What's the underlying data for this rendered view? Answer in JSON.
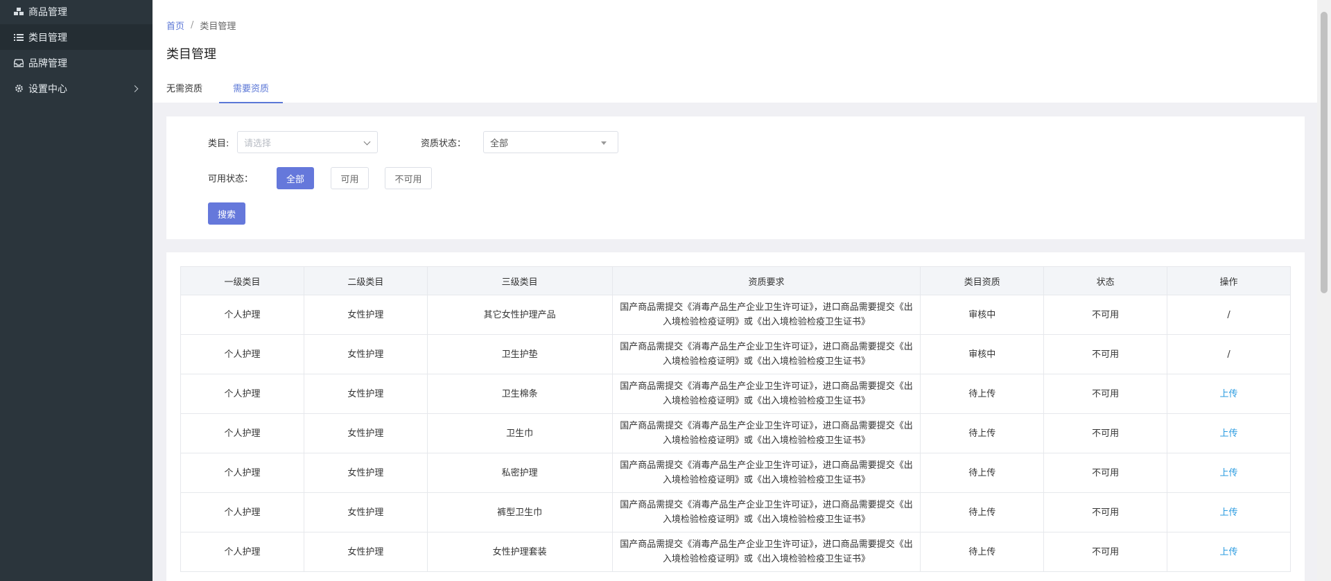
{
  "sidebar": {
    "items": [
      {
        "label": "商品管理",
        "icon": "cubes-icon"
      },
      {
        "label": "类目管理",
        "icon": "list-icon"
      },
      {
        "label": "品牌管理",
        "icon": "inbox-icon"
      },
      {
        "label": "设置中心",
        "icon": "gear-icon"
      }
    ]
  },
  "breadcrumb": {
    "home": "首页",
    "separator": "/",
    "current": "类目管理"
  },
  "page": {
    "title": "类目管理"
  },
  "tabs": [
    {
      "label": "无需资质"
    },
    {
      "label": "需要资质"
    }
  ],
  "filter": {
    "category_label": "类目:",
    "category_placeholder": "请选择",
    "qual_status_label": "资质状态：",
    "qual_status_value": "全部",
    "avail_label": "可用状态：",
    "avail_options": [
      "全部",
      "可用",
      "不可用"
    ],
    "search_label": "搜索"
  },
  "table": {
    "headers": [
      "一级类目",
      "二级类目",
      "三级类目",
      "资质要求",
      "类目资质",
      "状态",
      "操作"
    ],
    "rows": [
      {
        "c1": "个人护理",
        "c2": "女性护理",
        "c3": "其它女性护理产品",
        "req": "国产商品需提交《消毒产品生产企业卫生许可证》，进口商品需要提交《出入境检验检疫证明》或《出入境检验检疫卫生证书》",
        "qual": "审核中",
        "status": "不可用",
        "op": "/"
      },
      {
        "c1": "个人护理",
        "c2": "女性护理",
        "c3": "卫生护垫",
        "req": "国产商品需提交《消毒产品生产企业卫生许可证》，进口商品需要提交《出入境检验检疫证明》或《出入境检验检疫卫生证书》",
        "qual": "审核中",
        "status": "不可用",
        "op": "/"
      },
      {
        "c1": "个人护理",
        "c2": "女性护理",
        "c3": "卫生棉条",
        "req": "国产商品需提交《消毒产品生产企业卫生许可证》，进口商品需要提交《出入境检验检疫证明》或《出入境检验检疫卫生证书》",
        "qual": "待上传",
        "status": "不可用",
        "op": "上传"
      },
      {
        "c1": "个人护理",
        "c2": "女性护理",
        "c3": "卫生巾",
        "req": "国产商品需提交《消毒产品生产企业卫生许可证》，进口商品需要提交《出入境检验检疫证明》或《出入境检验检疫卫生证书》",
        "qual": "待上传",
        "status": "不可用",
        "op": "上传"
      },
      {
        "c1": "个人护理",
        "c2": "女性护理",
        "c3": "私密护理",
        "req": "国产商品需提交《消毒产品生产企业卫生许可证》，进口商品需要提交《出入境检验检疫证明》或《出入境检验检疫卫生证书》",
        "qual": "待上传",
        "status": "不可用",
        "op": "上传"
      },
      {
        "c1": "个人护理",
        "c2": "女性护理",
        "c3": "裤型卫生巾",
        "req": "国产商品需提交《消毒产品生产企业卫生许可证》，进口商品需要提交《出入境检验检疫证明》或《出入境检验检疫卫生证书》",
        "qual": "待上传",
        "status": "不可用",
        "op": "上传"
      },
      {
        "c1": "个人护理",
        "c2": "女性护理",
        "c3": "女性护理套装",
        "req": "国产商品需提交《消毒产品生产企业卫生许可证》，进口商品需要提交《出入境检验检疫证明》或《出入境检验检疫卫生证书》",
        "qual": "待上传",
        "status": "不可用",
        "op": "上传"
      }
    ]
  },
  "colors": {
    "accent": "#6578db",
    "link": "#2a9be0",
    "sidebar_bg": "#2b353c"
  }
}
